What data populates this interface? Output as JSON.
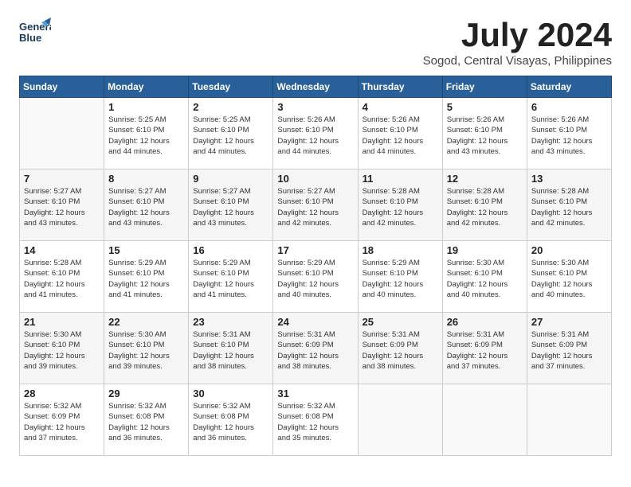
{
  "header": {
    "logo_line1": "General",
    "logo_line2": "Blue",
    "month_title": "July 2024",
    "location": "Sogod, Central Visayas, Philippines"
  },
  "days_of_week": [
    "Sunday",
    "Monday",
    "Tuesday",
    "Wednesday",
    "Thursday",
    "Friday",
    "Saturday"
  ],
  "weeks": [
    [
      {
        "day": "",
        "info": ""
      },
      {
        "day": "1",
        "info": "Sunrise: 5:25 AM\nSunset: 6:10 PM\nDaylight: 12 hours\nand 44 minutes."
      },
      {
        "day": "2",
        "info": "Sunrise: 5:25 AM\nSunset: 6:10 PM\nDaylight: 12 hours\nand 44 minutes."
      },
      {
        "day": "3",
        "info": "Sunrise: 5:26 AM\nSunset: 6:10 PM\nDaylight: 12 hours\nand 44 minutes."
      },
      {
        "day": "4",
        "info": "Sunrise: 5:26 AM\nSunset: 6:10 PM\nDaylight: 12 hours\nand 44 minutes."
      },
      {
        "day": "5",
        "info": "Sunrise: 5:26 AM\nSunset: 6:10 PM\nDaylight: 12 hours\nand 43 minutes."
      },
      {
        "day": "6",
        "info": "Sunrise: 5:26 AM\nSunset: 6:10 PM\nDaylight: 12 hours\nand 43 minutes."
      }
    ],
    [
      {
        "day": "7",
        "info": "Sunrise: 5:27 AM\nSunset: 6:10 PM\nDaylight: 12 hours\nand 43 minutes."
      },
      {
        "day": "8",
        "info": "Sunrise: 5:27 AM\nSunset: 6:10 PM\nDaylight: 12 hours\nand 43 minutes."
      },
      {
        "day": "9",
        "info": "Sunrise: 5:27 AM\nSunset: 6:10 PM\nDaylight: 12 hours\nand 43 minutes."
      },
      {
        "day": "10",
        "info": "Sunrise: 5:27 AM\nSunset: 6:10 PM\nDaylight: 12 hours\nand 42 minutes."
      },
      {
        "day": "11",
        "info": "Sunrise: 5:28 AM\nSunset: 6:10 PM\nDaylight: 12 hours\nand 42 minutes."
      },
      {
        "day": "12",
        "info": "Sunrise: 5:28 AM\nSunset: 6:10 PM\nDaylight: 12 hours\nand 42 minutes."
      },
      {
        "day": "13",
        "info": "Sunrise: 5:28 AM\nSunset: 6:10 PM\nDaylight: 12 hours\nand 42 minutes."
      }
    ],
    [
      {
        "day": "14",
        "info": "Sunrise: 5:28 AM\nSunset: 6:10 PM\nDaylight: 12 hours\nand 41 minutes."
      },
      {
        "day": "15",
        "info": "Sunrise: 5:29 AM\nSunset: 6:10 PM\nDaylight: 12 hours\nand 41 minutes."
      },
      {
        "day": "16",
        "info": "Sunrise: 5:29 AM\nSunset: 6:10 PM\nDaylight: 12 hours\nand 41 minutes."
      },
      {
        "day": "17",
        "info": "Sunrise: 5:29 AM\nSunset: 6:10 PM\nDaylight: 12 hours\nand 40 minutes."
      },
      {
        "day": "18",
        "info": "Sunrise: 5:29 AM\nSunset: 6:10 PM\nDaylight: 12 hours\nand 40 minutes."
      },
      {
        "day": "19",
        "info": "Sunrise: 5:30 AM\nSunset: 6:10 PM\nDaylight: 12 hours\nand 40 minutes."
      },
      {
        "day": "20",
        "info": "Sunrise: 5:30 AM\nSunset: 6:10 PM\nDaylight: 12 hours\nand 40 minutes."
      }
    ],
    [
      {
        "day": "21",
        "info": "Sunrise: 5:30 AM\nSunset: 6:10 PM\nDaylight: 12 hours\nand 39 minutes."
      },
      {
        "day": "22",
        "info": "Sunrise: 5:30 AM\nSunset: 6:10 PM\nDaylight: 12 hours\nand 39 minutes."
      },
      {
        "day": "23",
        "info": "Sunrise: 5:31 AM\nSunset: 6:10 PM\nDaylight: 12 hours\nand 38 minutes."
      },
      {
        "day": "24",
        "info": "Sunrise: 5:31 AM\nSunset: 6:09 PM\nDaylight: 12 hours\nand 38 minutes."
      },
      {
        "day": "25",
        "info": "Sunrise: 5:31 AM\nSunset: 6:09 PM\nDaylight: 12 hours\nand 38 minutes."
      },
      {
        "day": "26",
        "info": "Sunrise: 5:31 AM\nSunset: 6:09 PM\nDaylight: 12 hours\nand 37 minutes."
      },
      {
        "day": "27",
        "info": "Sunrise: 5:31 AM\nSunset: 6:09 PM\nDaylight: 12 hours\nand 37 minutes."
      }
    ],
    [
      {
        "day": "28",
        "info": "Sunrise: 5:32 AM\nSunset: 6:09 PM\nDaylight: 12 hours\nand 37 minutes."
      },
      {
        "day": "29",
        "info": "Sunrise: 5:32 AM\nSunset: 6:08 PM\nDaylight: 12 hours\nand 36 minutes."
      },
      {
        "day": "30",
        "info": "Sunrise: 5:32 AM\nSunset: 6:08 PM\nDaylight: 12 hours\nand 36 minutes."
      },
      {
        "day": "31",
        "info": "Sunrise: 5:32 AM\nSunset: 6:08 PM\nDaylight: 12 hours\nand 35 minutes."
      },
      {
        "day": "",
        "info": ""
      },
      {
        "day": "",
        "info": ""
      },
      {
        "day": "",
        "info": ""
      }
    ]
  ]
}
